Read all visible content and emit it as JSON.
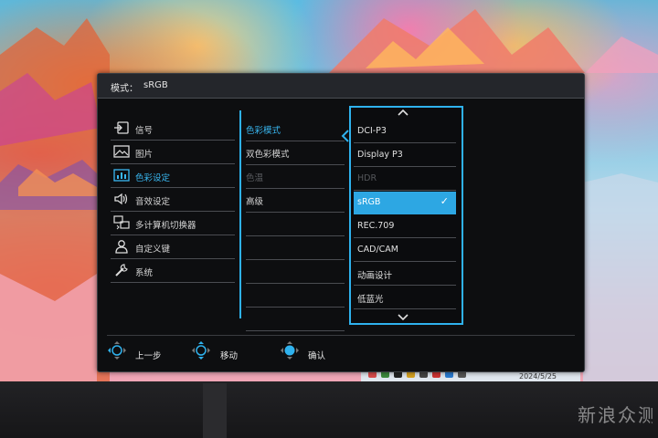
{
  "osd": {
    "mode_label": "模式：",
    "mode_value": "sRGB",
    "main_menu": [
      {
        "label": "信号",
        "icon": "input-icon"
      },
      {
        "label": "图片",
        "icon": "picture-icon"
      },
      {
        "label": "色彩设定",
        "icon": "color-setting-icon",
        "active": true
      },
      {
        "label": "音效设定",
        "icon": "speaker-icon"
      },
      {
        "label": "多计算机切换器",
        "icon": "kvm-switch-icon"
      },
      {
        "label": "自定义键",
        "icon": "user-icon"
      },
      {
        "label": "系统",
        "icon": "wrench-icon"
      }
    ],
    "sub_menu": [
      {
        "label": "色彩模式",
        "active": true
      },
      {
        "label": "双色彩模式"
      },
      {
        "label": "色温",
        "dim": true
      },
      {
        "label": "高级"
      }
    ],
    "color_modes": [
      {
        "label": "DCI-P3"
      },
      {
        "label": "Display P3"
      },
      {
        "label": "HDR",
        "dim": true
      },
      {
        "label": "sRGB",
        "selected": true
      },
      {
        "label": "REC.709"
      },
      {
        "label": "CAD/CAM"
      },
      {
        "label": "动画设计"
      },
      {
        "label": "低蓝光"
      }
    ],
    "check_mark": "✓",
    "footer": {
      "back": "上一步",
      "move": "移动",
      "confirm": "确认"
    }
  },
  "taskbar": {
    "date": "2024/5/25"
  },
  "watermark": "新浪众测",
  "colors": {
    "accent": "#2fb2ee",
    "selected_bg": "#2da7e3",
    "osd_bg": "#0d0e10"
  }
}
